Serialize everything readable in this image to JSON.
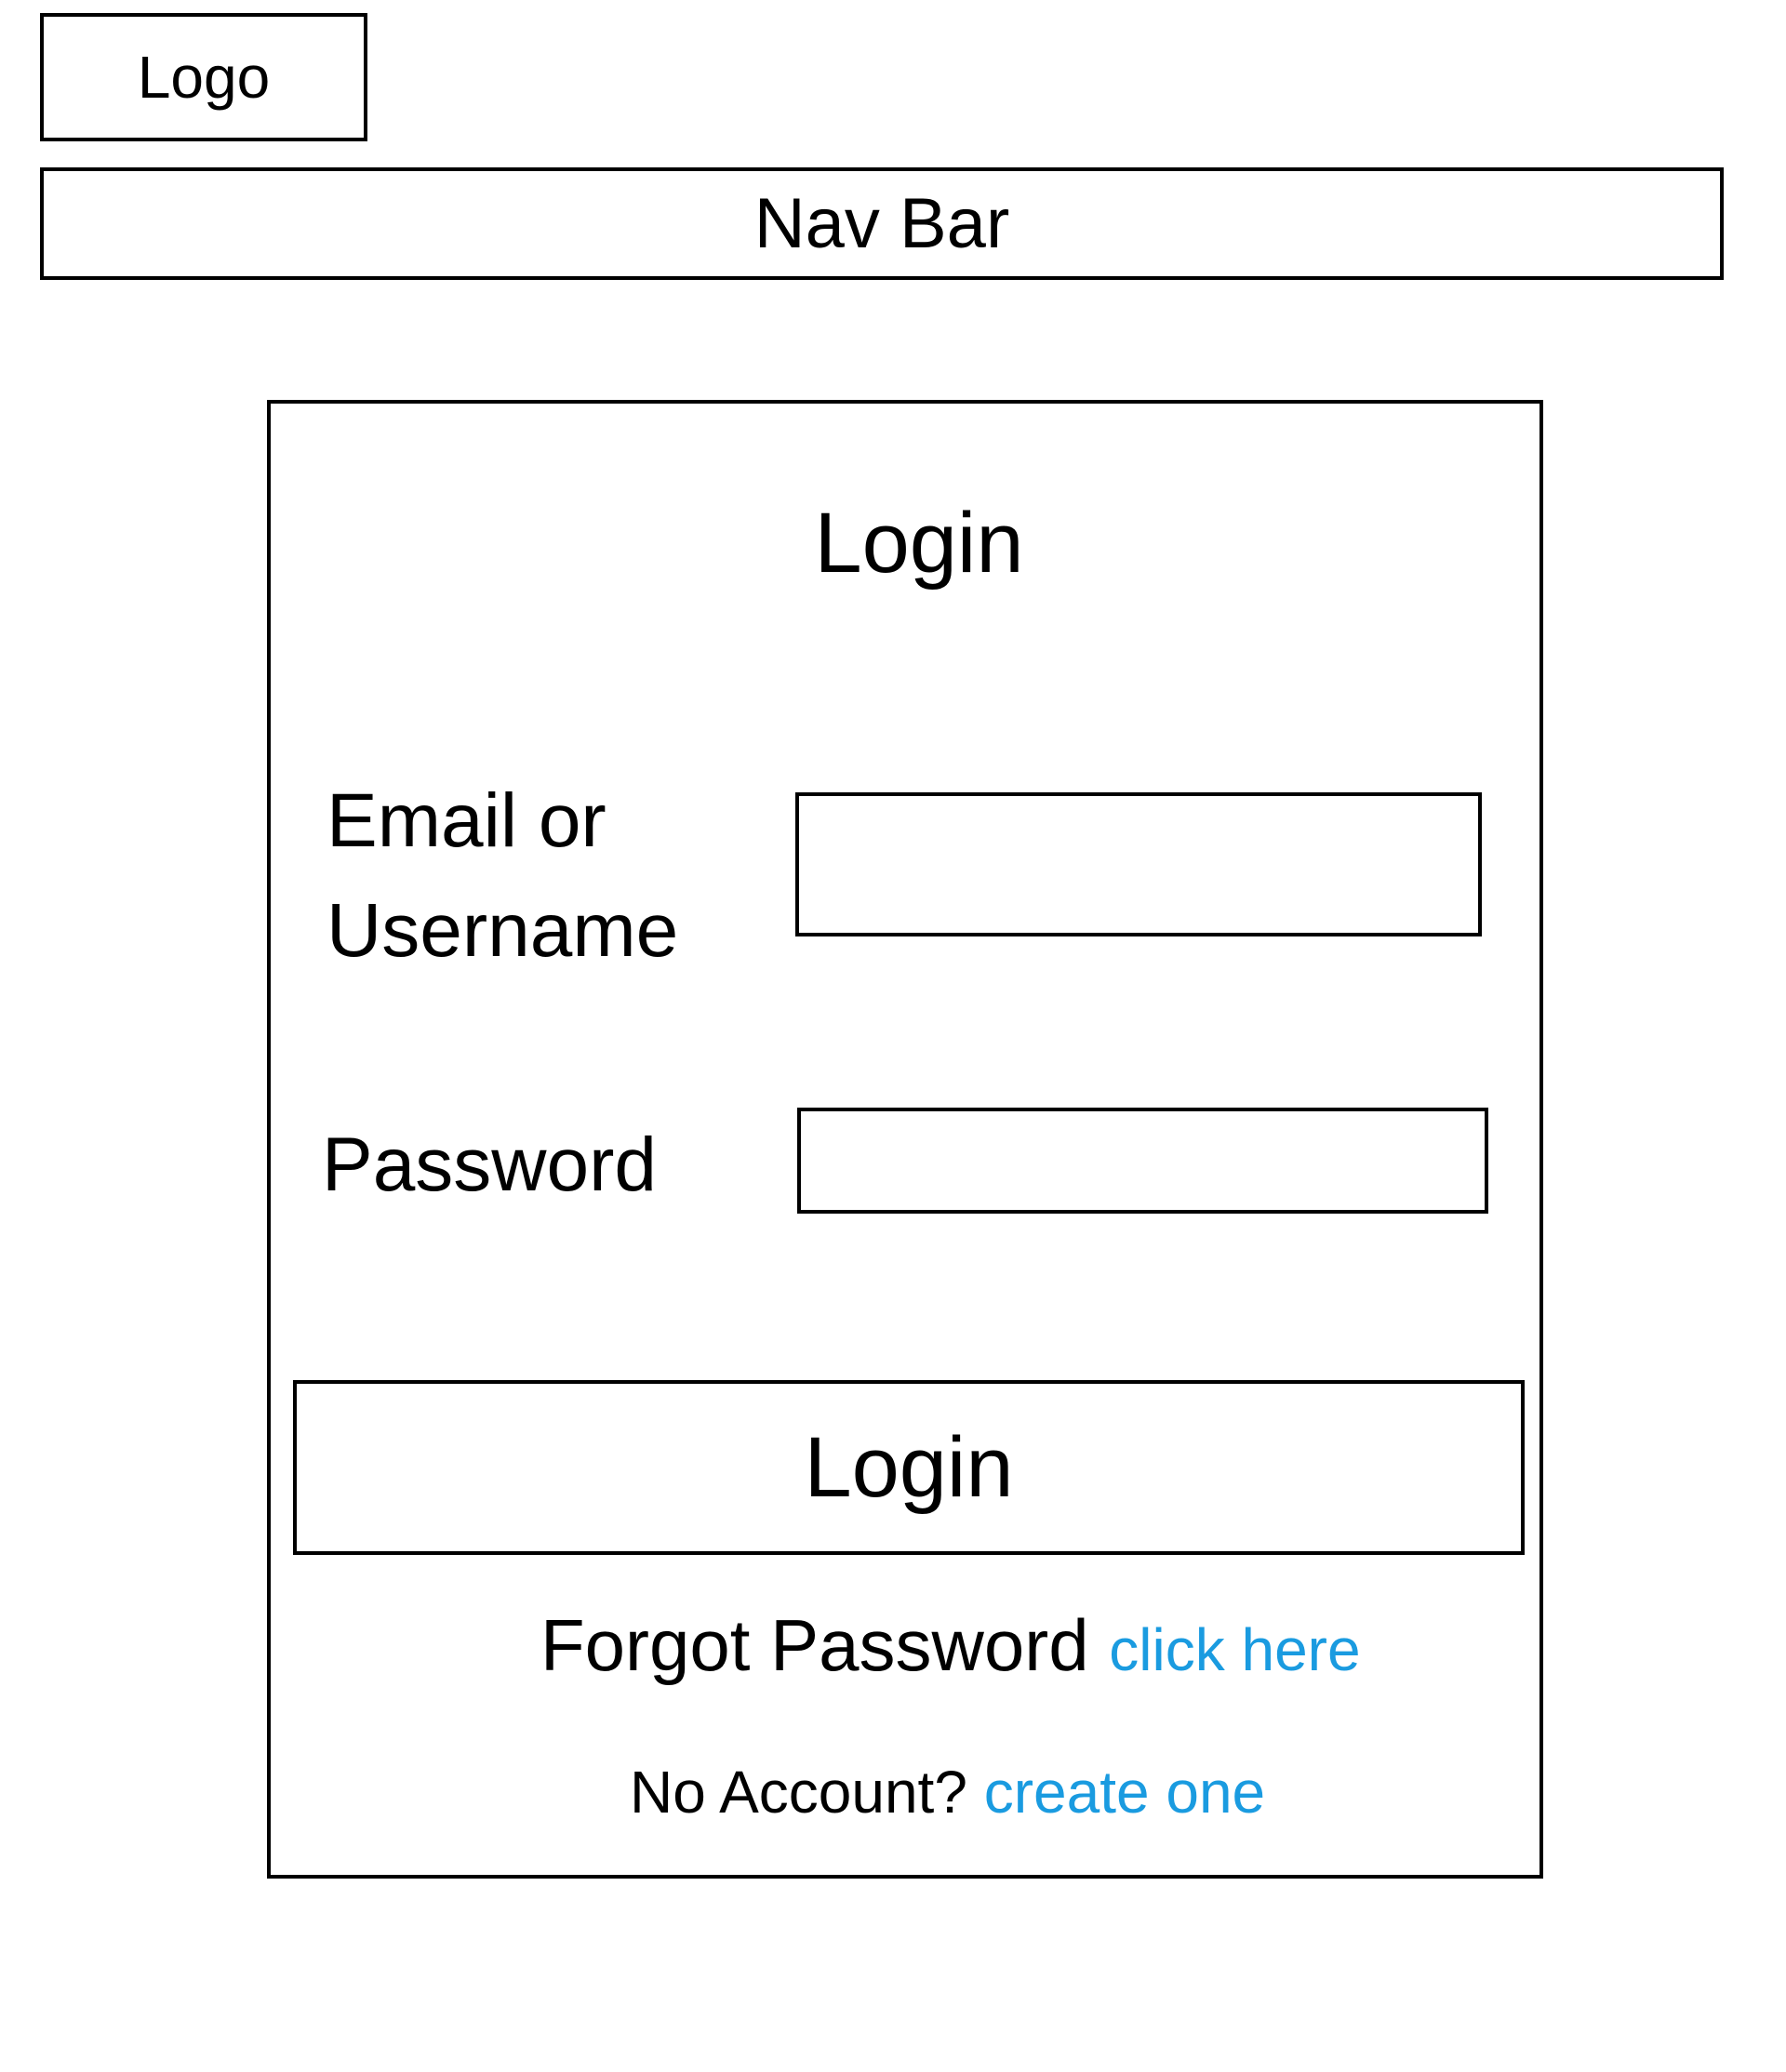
{
  "header": {
    "logo_label": "Logo",
    "nav_label": "Nav Bar"
  },
  "login_card": {
    "title": "Login",
    "email_label_line1": "Email or",
    "email_label_line2": "Username",
    "email_value": "",
    "password_label": "Password",
    "password_value": "",
    "submit_label": "Login",
    "forgot_text": "Forgot Password",
    "forgot_link": "click here",
    "no_account_text": "No Account?",
    "create_link": "create one"
  },
  "colors": {
    "link": "#1a9be0",
    "border": "#000000",
    "background": "#ffffff"
  }
}
